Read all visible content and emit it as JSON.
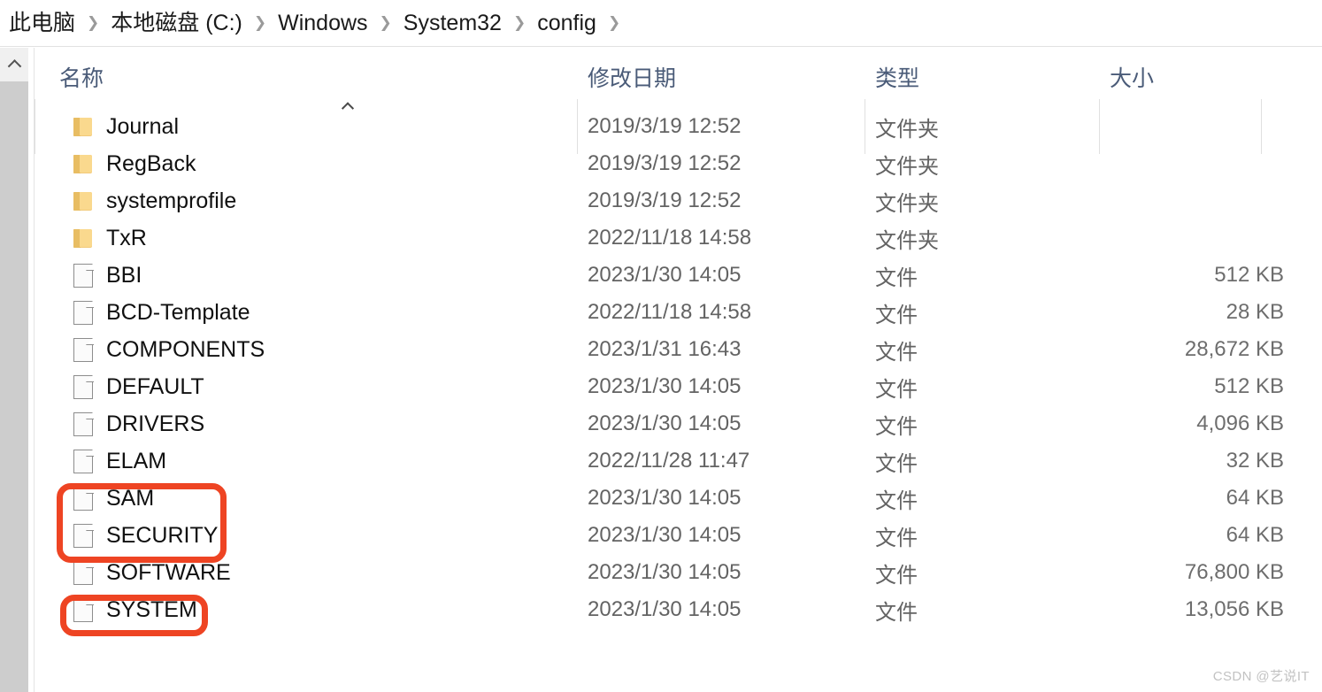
{
  "breadcrumb": {
    "separator": "❯",
    "items": [
      {
        "label": "此电脑"
      },
      {
        "label": "本地磁盘 (C:)"
      },
      {
        "label": "Windows"
      },
      {
        "label": "System32"
      },
      {
        "label": "config"
      }
    ],
    "trailing_separator": "❯"
  },
  "columns": {
    "name": "名称",
    "date_modified": "修改日期",
    "type": "类型",
    "size": "大小",
    "sort_indicator": "ascending",
    "sorted_by": "名称"
  },
  "types": {
    "folder": "文件夹",
    "file": "文件"
  },
  "rows": [
    {
      "name": "Journal",
      "icon": "folder-icon",
      "date": "2019/3/19 12:52",
      "type": "文件夹",
      "size": ""
    },
    {
      "name": "RegBack",
      "icon": "folder-icon",
      "date": "2019/3/19 12:52",
      "type": "文件夹",
      "size": ""
    },
    {
      "name": "systemprofile",
      "icon": "folder-icon",
      "date": "2019/3/19 12:52",
      "type": "文件夹",
      "size": ""
    },
    {
      "name": "TxR",
      "icon": "folder-icon",
      "date": "2022/11/18 14:58",
      "type": "文件夹",
      "size": ""
    },
    {
      "name": "BBI",
      "icon": "file-icon",
      "date": "2023/1/30 14:05",
      "type": "文件",
      "size": "512 KB"
    },
    {
      "name": "BCD-Template",
      "icon": "file-icon",
      "date": "2022/11/18 14:58",
      "type": "文件",
      "size": "28 KB"
    },
    {
      "name": "COMPONENTS",
      "icon": "file-icon",
      "date": "2023/1/31 16:43",
      "type": "文件",
      "size": "28,672 KB"
    },
    {
      "name": "DEFAULT",
      "icon": "file-icon",
      "date": "2023/1/30 14:05",
      "type": "文件",
      "size": "512 KB"
    },
    {
      "name": "DRIVERS",
      "icon": "file-icon",
      "date": "2023/1/30 14:05",
      "type": "文件",
      "size": "4,096 KB"
    },
    {
      "name": "ELAM",
      "icon": "file-icon",
      "date": "2022/11/28 11:47",
      "type": "文件",
      "size": "32 KB"
    },
    {
      "name": "SAM",
      "icon": "file-icon",
      "date": "2023/1/30 14:05",
      "type": "文件",
      "size": "64 KB"
    },
    {
      "name": "SECURITY",
      "icon": "file-icon",
      "date": "2023/1/30 14:05",
      "type": "文件",
      "size": "64 KB"
    },
    {
      "name": "SOFTWARE",
      "icon": "file-icon",
      "date": "2023/1/30 14:05",
      "type": "文件",
      "size": "76,800 KB"
    },
    {
      "name": "SYSTEM",
      "icon": "file-icon",
      "date": "2023/1/30 14:05",
      "type": "文件",
      "size": "13,056 KB"
    }
  ],
  "annotations": {
    "color": "#ee4423",
    "boxes": [
      {
        "name": "sam-security-highlight",
        "targets": [
          "SAM",
          "SECURITY"
        ]
      },
      {
        "name": "system-highlight",
        "targets": [
          "SYSTEM"
        ]
      }
    ]
  },
  "scrollbar": {
    "up_arrow": "▲",
    "orientation": "vertical"
  },
  "watermark": {
    "text": "CSDN @艺说IT"
  }
}
